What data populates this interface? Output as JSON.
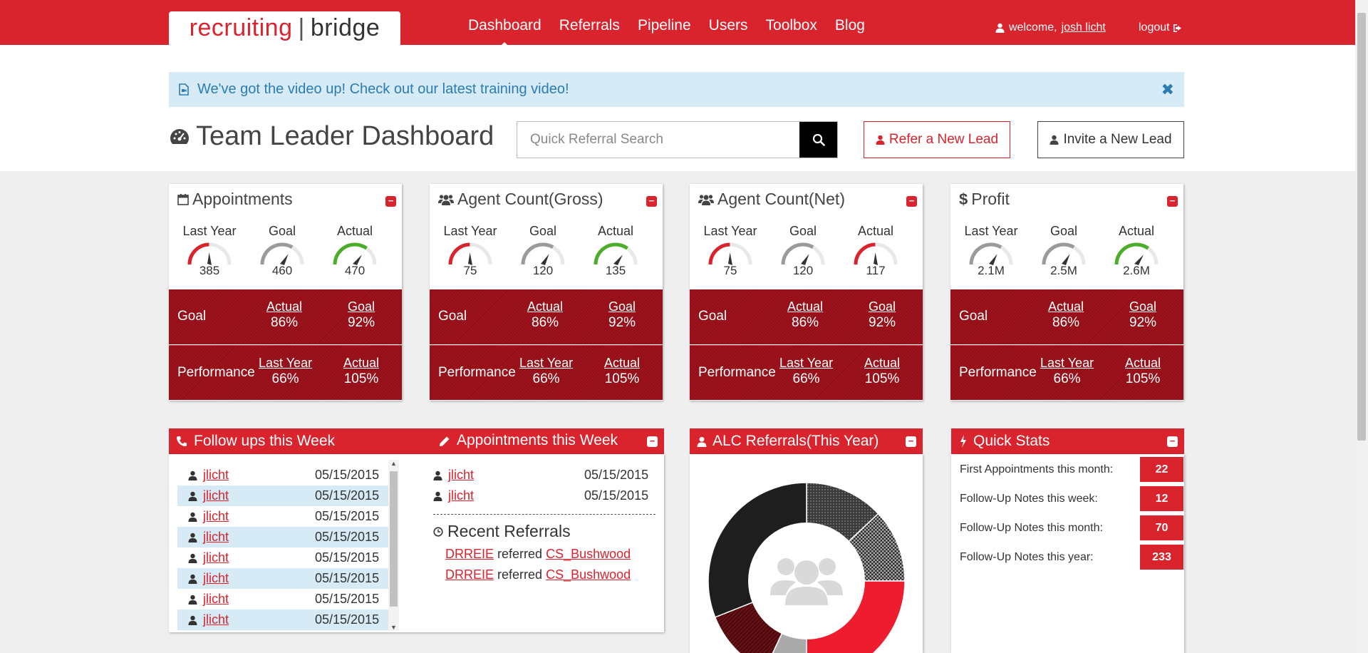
{
  "brand": {
    "part1": "recruiting",
    "separator": "|",
    "part2": "bridge"
  },
  "nav": [
    {
      "label": "Dashboard",
      "active": true
    },
    {
      "label": "Referrals"
    },
    {
      "label": "Pipeline"
    },
    {
      "label": "Users"
    },
    {
      "label": "Toolbox"
    },
    {
      "label": "Blog"
    }
  ],
  "user": {
    "welcome": "welcome,",
    "name": "josh licht",
    "logout": "logout"
  },
  "alert": {
    "text": "We've got the video up! Check out our latest training video!",
    "close": "✖"
  },
  "page": {
    "title": "Team Leader Dashboard"
  },
  "search": {
    "placeholder": "Quick Referral Search"
  },
  "buttons": {
    "refer": "Refer a New Lead",
    "invite": "Invite a New Lead"
  },
  "colors": {
    "brand_red": "#d9232d",
    "dark_red": "#a1121c",
    "info_blue": "#d6ebf6",
    "gauge_green": "#4aae2b",
    "gauge_gray": "#9a9a9a"
  },
  "cards": [
    {
      "title": "Appointments",
      "icon": "calendar-icon",
      "gauges": [
        {
          "label": "Last Year",
          "value": "385",
          "color": "red"
        },
        {
          "label": "Goal",
          "value": "460",
          "color": "gray"
        },
        {
          "label": "Actual",
          "value": "470",
          "color": "green"
        }
      ],
      "goal_row": {
        "label": "Goal",
        "col1_head": "Actual",
        "col1_val": "86%",
        "col2_head": "Goal",
        "col2_val": "92%"
      },
      "perf_row": {
        "label": "Performance",
        "col1_head": "Last Year",
        "col1_val": "66%",
        "col2_head": "Actual",
        "col2_val": "105%"
      }
    },
    {
      "title": "Agent Count(Gross)",
      "icon": "users-icon",
      "gauges": [
        {
          "label": "Last Year",
          "value": "75",
          "color": "red"
        },
        {
          "label": "Goal",
          "value": "120",
          "color": "gray"
        },
        {
          "label": "Actual",
          "value": "135",
          "color": "green"
        }
      ],
      "goal_row": {
        "label": "Goal",
        "col1_head": "Actual",
        "col1_val": "86%",
        "col2_head": "Goal",
        "col2_val": "92%"
      },
      "perf_row": {
        "label": "Performance",
        "col1_head": "Last Year",
        "col1_val": "66%",
        "col2_head": "Actual",
        "col2_val": "105%"
      }
    },
    {
      "title": "Agent Count(Net)",
      "icon": "users-icon",
      "gauges": [
        {
          "label": "Last Year",
          "value": "75",
          "color": "red"
        },
        {
          "label": "Goal",
          "value": "120",
          "color": "gray"
        },
        {
          "label": "Actual",
          "value": "117",
          "color": "red"
        }
      ],
      "goal_row": {
        "label": "Goal",
        "col1_head": "Actual",
        "col1_val": "86%",
        "col2_head": "Goal",
        "col2_val": "92%"
      },
      "perf_row": {
        "label": "Performance",
        "col1_head": "Last Year",
        "col1_val": "66%",
        "col2_head": "Actual",
        "col2_val": "105%"
      }
    },
    {
      "title": "Profit",
      "icon": "dollar-icon",
      "gauges": [
        {
          "label": "Last Year",
          "value": "2.1M",
          "color": "gray"
        },
        {
          "label": "Goal",
          "value": "2.5M",
          "color": "gray"
        },
        {
          "label": "Actual",
          "value": "2.6M",
          "color": "green"
        }
      ],
      "goal_row": {
        "label": "Goal",
        "col1_head": "Actual",
        "col1_val": "86%",
        "col2_head": "Goal",
        "col2_val": "92%"
      },
      "perf_row": {
        "label": "Performance",
        "col1_head": "Last Year",
        "col1_val": "66%",
        "col2_head": "Actual",
        "col2_val": "105%"
      }
    }
  ],
  "followups": {
    "title": "Follow ups this Week",
    "rows": [
      {
        "name": "jlicht",
        "date": "05/15/2015"
      },
      {
        "name": "jlicht",
        "date": "05/15/2015"
      },
      {
        "name": "jlicht",
        "date": "05/15/2015"
      },
      {
        "name": "jlicht",
        "date": "05/15/2015"
      },
      {
        "name": "jlicht",
        "date": "05/15/2015"
      },
      {
        "name": "jlicht",
        "date": "05/15/2015"
      },
      {
        "name": "jlicht",
        "date": "05/15/2015"
      },
      {
        "name": "jlicht",
        "date": "05/15/2015"
      }
    ]
  },
  "appointments_week": {
    "title": "Appointments this Week",
    "rows": [
      {
        "name": "jlicht",
        "date": "05/15/2015"
      },
      {
        "name": "jlicht",
        "date": "05/15/2015"
      }
    ]
  },
  "recent_referrals": {
    "title": "Recent Referrals",
    "rows": [
      {
        "from": "DRREIE",
        "verb": "referred",
        "to": "CS_Bushwood"
      },
      {
        "from": "DRREIE",
        "verb": "referred",
        "to": "CS_Bushwood"
      }
    ]
  },
  "alc": {
    "title": "ALC Referrals(This Year)",
    "chart_data": {
      "type": "pie",
      "labels": [],
      "values": [
        13,
        12,
        25,
        7,
        12,
        31
      ],
      "colors": [
        "#555555",
        "#777777",
        "#ee1c2e",
        "#aaaaaa",
        "#6b1015",
        "#1e1e1e"
      ],
      "patterns": [
        "dots",
        "checks",
        "none",
        "none",
        "stripes",
        "none"
      ]
    }
  },
  "quick_stats": {
    "title": "Quick Stats",
    "rows": [
      {
        "label": "First Appointments this month:",
        "value": "22"
      },
      {
        "label": "Follow-Up Notes this week:",
        "value": "12"
      },
      {
        "label": "Follow-Up Notes this month:",
        "value": "70"
      },
      {
        "label": "Follow-Up Notes this year:",
        "value": "233"
      }
    ]
  }
}
